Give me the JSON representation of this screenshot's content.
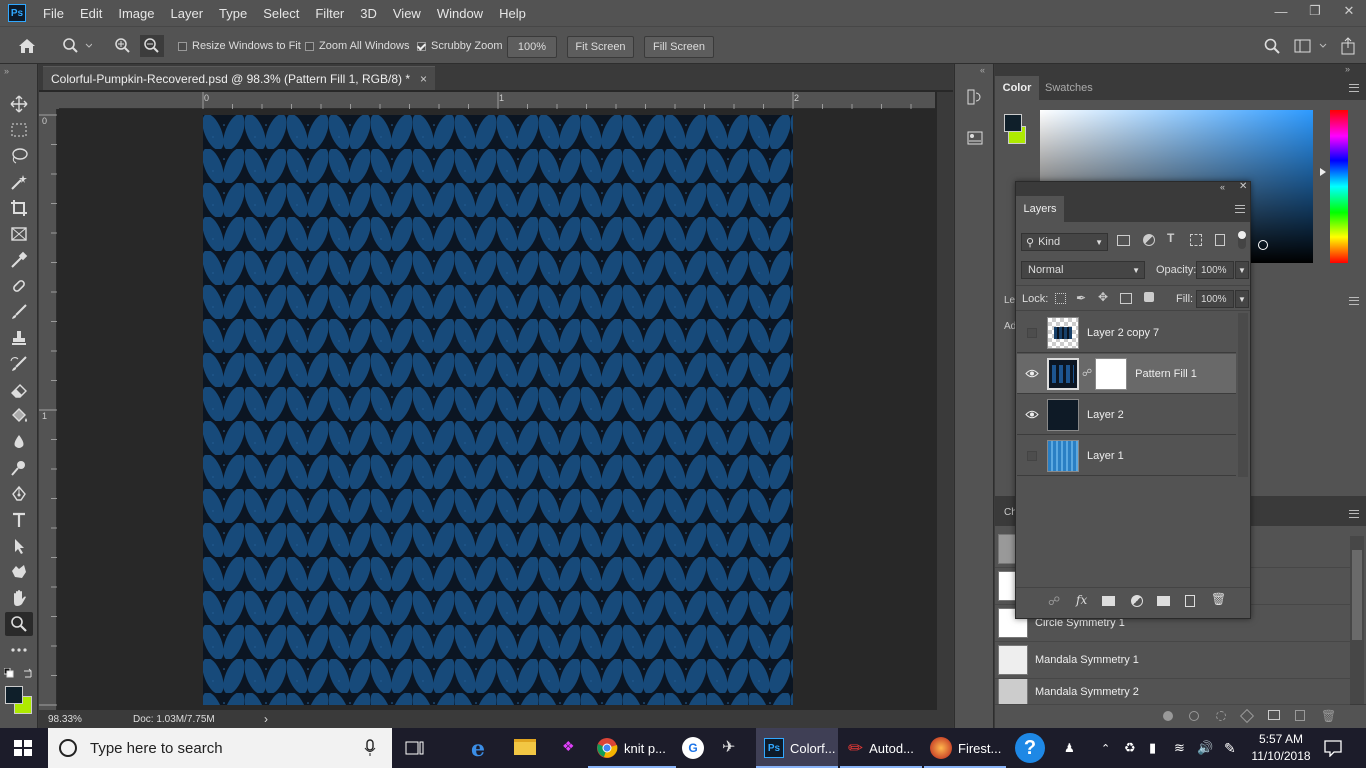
{
  "app": {
    "logo_text": "Ps",
    "menu": [
      "File",
      "Edit",
      "Image",
      "Layer",
      "Type",
      "Select",
      "Filter",
      "3D",
      "View",
      "Window",
      "Help"
    ]
  },
  "options_bar": {
    "resize_windows": "Resize Windows to Fit",
    "zoom_all": "Zoom All Windows",
    "scrubby_zoom": "Scrubby Zoom",
    "zoom_value": "100%",
    "fit_screen": "Fit Screen",
    "fill_screen": "Fill Screen"
  },
  "document": {
    "tab_title": "Colorful-Pumpkin-Recovered.psd @ 98.3% (Pattern Fill 1, RGB/8) *",
    "close": "×",
    "ruler_top": [
      "0",
      "1",
      "2"
    ],
    "ruler_left": [
      "0",
      "1"
    ],
    "zoom_status": "98.33%",
    "doc_size": "Doc: 1.03M/7.75M",
    "status_arrow": "›"
  },
  "color_panel": {
    "tabs": [
      "Color",
      "Swatches"
    ],
    "foreground": "#0f1f2a",
    "background": "#aeea00"
  },
  "layers_panel": {
    "title": "Layers",
    "filter_kind": "Kind",
    "blend_mode": "Normal",
    "opacity_label": "Opacity:",
    "opacity_value": "100%",
    "lock_label": "Lock:",
    "fill_label": "Fill:",
    "fill_value": "100%",
    "fx_label": "fx",
    "layers": [
      {
        "name": "Layer 2 copy 7",
        "visible": false,
        "selected": false
      },
      {
        "name": "Pattern Fill 1",
        "visible": true,
        "selected": true
      },
      {
        "name": "Layer 2",
        "visible": true,
        "selected": false
      },
      {
        "name": "Layer 1",
        "visible": false,
        "selected": false
      }
    ]
  },
  "hidden_panels": {
    "le_label": "Le",
    "ad_label": "Ad",
    "ch_label": "Ch"
  },
  "history_items": [
    "Circle Symmetry 1",
    "Mandala Symmetry 1",
    "Mandala Symmetry 2"
  ],
  "taskbar": {
    "search_placeholder": "Type here to search",
    "apps": [
      {
        "label": "knit p..."
      },
      {
        "label": "Colorf..."
      },
      {
        "label": "Autod..."
      },
      {
        "label": "Firest..."
      }
    ],
    "time": "5:57 AM",
    "date": "11/10/2018"
  }
}
